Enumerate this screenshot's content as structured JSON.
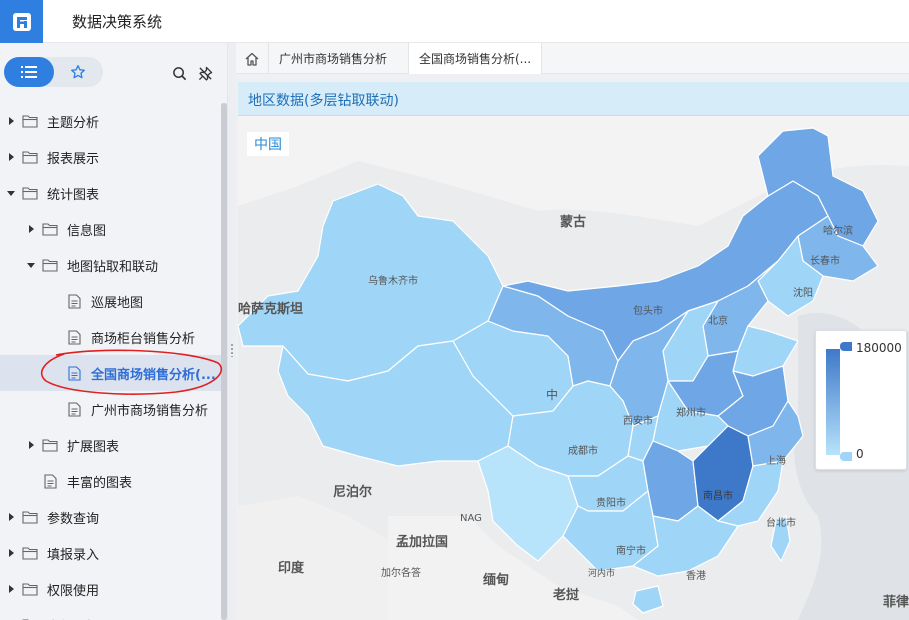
{
  "app": {
    "title": "数据决策系统"
  },
  "sidebar": {
    "tree": [
      {
        "label": "主题分析",
        "level": 0,
        "kind": "folder",
        "expanded": false
      },
      {
        "label": "报表展示",
        "level": 0,
        "kind": "folder",
        "expanded": false
      },
      {
        "label": "统计图表",
        "level": 0,
        "kind": "folder",
        "expanded": true
      },
      {
        "label": "信息图",
        "level": 1,
        "kind": "folder",
        "expanded": false
      },
      {
        "label": "地图钻取和联动",
        "level": 1,
        "kind": "folder",
        "expanded": true
      },
      {
        "label": "巡展地图",
        "level": 2,
        "kind": "report"
      },
      {
        "label": "商场柜台销售分析",
        "level": 2,
        "kind": "report"
      },
      {
        "label": "全国商场销售分析(...",
        "level": 2,
        "kind": "report",
        "selected": true
      },
      {
        "label": "广州市商场销售分析",
        "level": 2,
        "kind": "report"
      },
      {
        "label": "扩展图表",
        "level": 1,
        "kind": "folder",
        "expanded": false
      },
      {
        "label": "丰富的图表",
        "level": 1,
        "kind": "report"
      },
      {
        "label": "参数查询",
        "level": 0,
        "kind": "folder",
        "expanded": false
      },
      {
        "label": "填报录入",
        "level": 0,
        "kind": "folder",
        "expanded": false
      },
      {
        "label": "权限使用",
        "level": 0,
        "kind": "folder",
        "expanded": false
      },
      {
        "label": "多级上报",
        "level": 0,
        "kind": "folder",
        "expanded": false
      }
    ]
  },
  "tabs": [
    {
      "label": "广州市商场销售分析",
      "active": false
    },
    {
      "label": "全国商场销售分析(...",
      "active": true
    }
  ],
  "panel": {
    "title": "地区数据(多层钻取联动)"
  },
  "map": {
    "breadcrumb": "中国",
    "legend_max": "180000",
    "legend_min": "0",
    "labels": [
      "蒙古",
      "乌鲁木齐市",
      "哈萨克斯坦",
      "哈尔滨",
      "长春市",
      "沈阳",
      "包头市",
      "北京",
      "中",
      "西安市",
      "郑州市",
      "成都市",
      "贵阳市",
      "南昌市",
      "上海",
      "台北市",
      "南宁市",
      "香港",
      "河内市",
      "尼泊尔",
      "孟加拉国",
      "印度",
      "加尔各答",
      "缅甸",
      "老挝",
      "NAG",
      "菲律宾"
    ]
  },
  "colors": {
    "accent": "#2f7fe0",
    "annotation": "#e02020"
  }
}
